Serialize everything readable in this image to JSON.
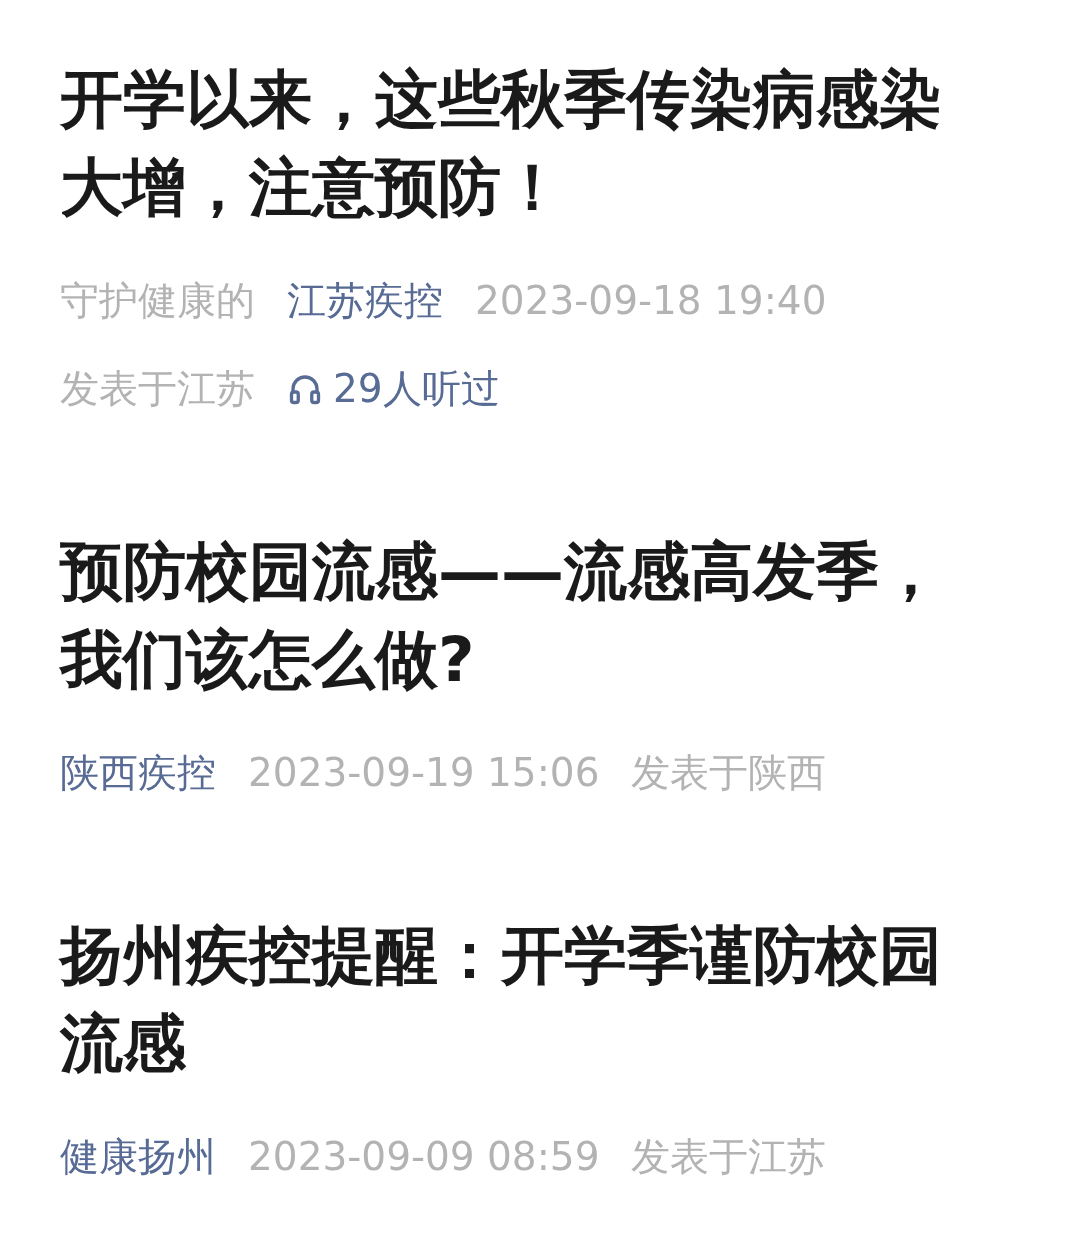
{
  "articles": [
    {
      "title": "开学以来，这些秋季传染病感染大增，注意预防！",
      "meta": [
        {
          "kind": "text",
          "text": "守护健康的"
        },
        {
          "kind": "account",
          "text": "江苏疾控"
        },
        {
          "kind": "text",
          "text": "2023-09-18 19:40"
        },
        {
          "kind": "text",
          "text": "发表于江苏"
        },
        {
          "kind": "listen",
          "text": "29人听过"
        }
      ]
    },
    {
      "title": "预防校园流感——流感高发季，我们该怎么做?",
      "meta": [
        {
          "kind": "account",
          "text": "陕西疾控"
        },
        {
          "kind": "text",
          "text": "2023-09-19 15:06"
        },
        {
          "kind": "text",
          "text": "发表于陕西"
        }
      ]
    },
    {
      "title": "扬州疾控提醒：开学季谨防校园流感",
      "meta": [
        {
          "kind": "account",
          "text": "健康扬州"
        },
        {
          "kind": "text",
          "text": "2023-09-09 08:59"
        },
        {
          "kind": "text",
          "text": "发表于江苏"
        }
      ]
    }
  ]
}
